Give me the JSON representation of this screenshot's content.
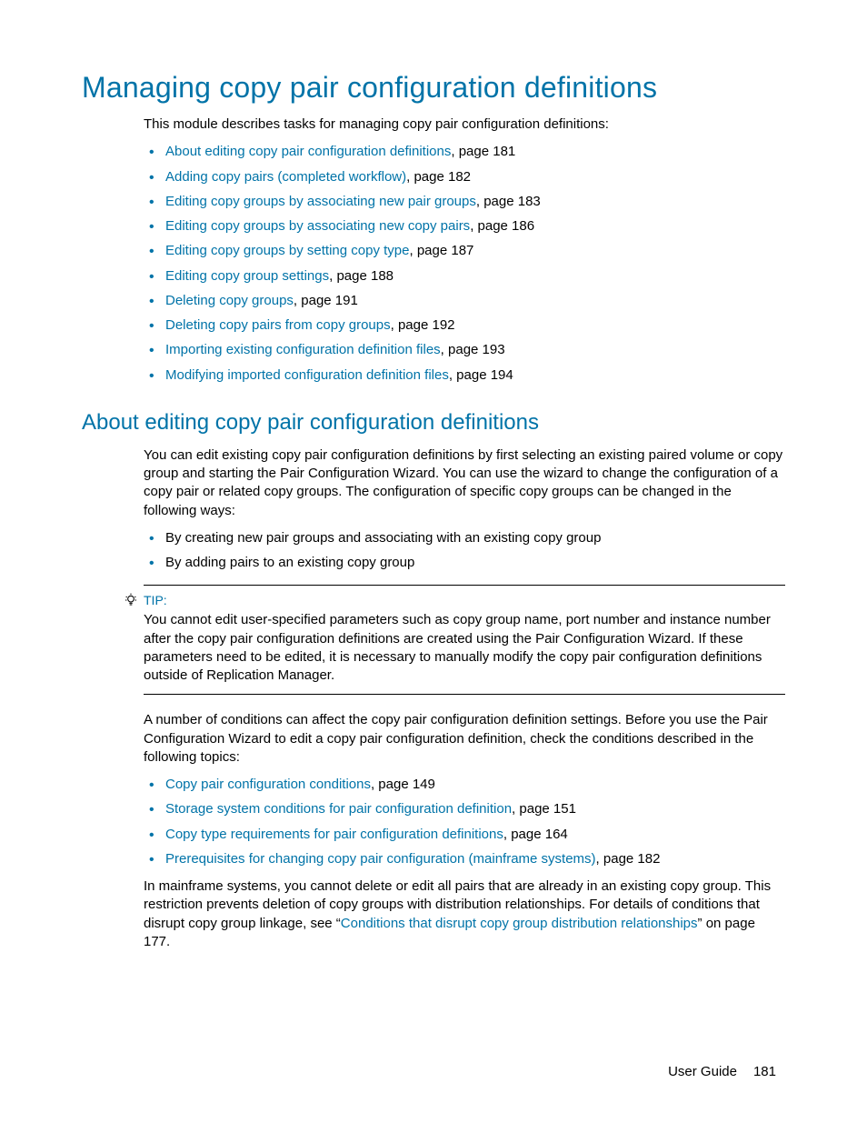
{
  "title": "Managing copy pair configuration definitions",
  "intro": "This module describes tasks for managing copy pair configuration definitions:",
  "toc": [
    {
      "text": "About editing copy pair configuration definitions",
      "page": "181"
    },
    {
      "text": "Adding copy pairs (completed workflow)",
      "page": "182"
    },
    {
      "text": "Editing copy groups by associating new pair groups",
      "page": "183"
    },
    {
      "text": "Editing copy groups by associating new copy pairs",
      "page": "186"
    },
    {
      "text": "Editing copy groups by setting copy type",
      "page": "187"
    },
    {
      "text": "Editing copy group settings",
      "page": "188"
    },
    {
      "text": "Deleting copy groups",
      "page": "191"
    },
    {
      "text": "Deleting copy pairs from copy groups",
      "page": "192"
    },
    {
      "text": "Importing existing configuration definition files",
      "page": "193"
    },
    {
      "text": "Modifying imported configuration definition files",
      "page": "194"
    }
  ],
  "section2_title": "About editing copy pair configuration definitions",
  "section2_p1": "You can edit existing copy pair configuration definitions by first selecting an existing paired volume or copy group and starting the Pair Configuration Wizard. You can use the wizard to change the configuration of a copy pair or related copy groups. The configuration of specific copy groups can be changed in the following ways:",
  "section2_bullets": [
    "By creating new pair groups and associating with an existing copy group",
    "By adding pairs to an existing copy group"
  ],
  "tip_label": "TIP:",
  "tip_text": "You cannot edit user-specified parameters such as copy group name, port number and instance number after the copy pair configuration definitions are created using the Pair Configuration Wizard. If these parameters need to be edited, it is necessary to manually modify the copy pair configuration definitions outside of Replication Manager.",
  "section2_p2": "A number of conditions can affect the copy pair configuration definition settings. Before you use the Pair Configuration Wizard to edit a copy pair configuration definition, check the conditions described in the following topics:",
  "conditions": [
    {
      "text": "Copy pair configuration conditions",
      "page": "149"
    },
    {
      "text": "Storage system conditions for pair configuration definition",
      "page": "151"
    },
    {
      "text": "Copy type requirements for pair configuration definitions",
      "page": "164"
    },
    {
      "text": "Prerequisites for changing copy pair configuration (mainframe systems)",
      "page": "182"
    }
  ],
  "final_pre": "In mainframe systems, you cannot delete or edit all pairs that are already in an existing copy group. This restriction prevents deletion of copy groups with distribution relationships. For details of conditions that disrupt copy group linkage, see “",
  "final_link": "Conditions that disrupt copy group distribution relationships",
  "final_post": "” on page 177.",
  "footer_label": "User Guide",
  "footer_page": "181"
}
